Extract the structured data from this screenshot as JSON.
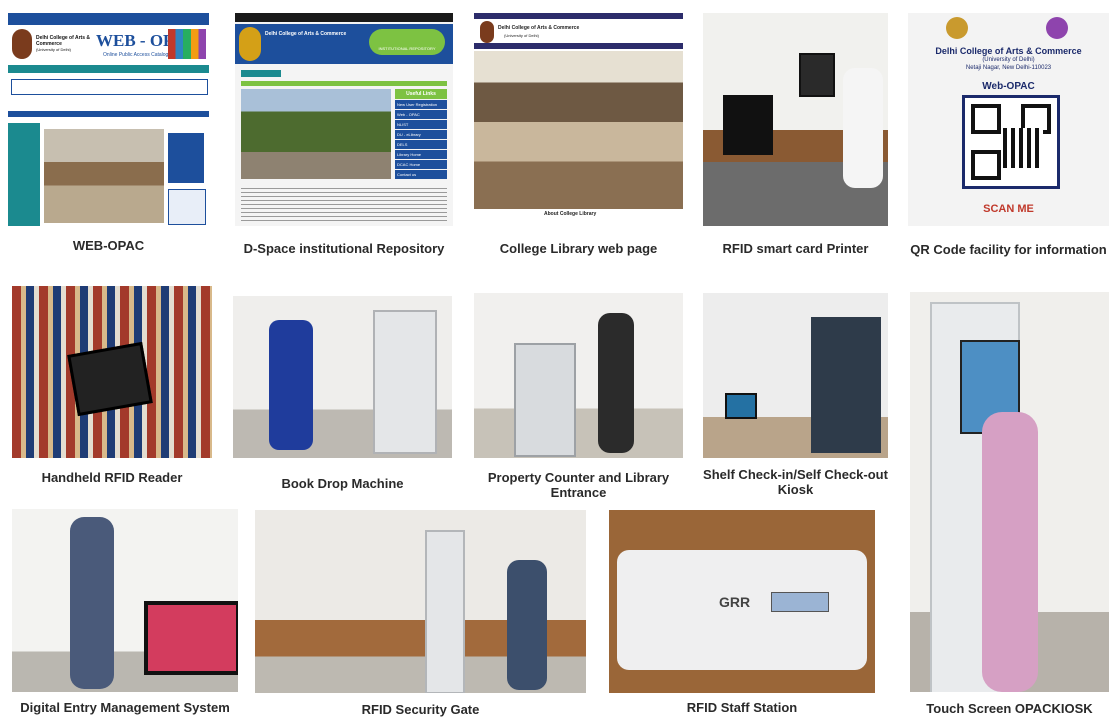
{
  "captions": {
    "web_opac": "WEB-OPAC",
    "dspace": "D-Space institutional Repository",
    "college_web": "College Library web page",
    "rfid_printer": "RFID smart card Printer",
    "qr_code": "QR Code facility for information",
    "handheld": "Handheld RFID Reader",
    "book_drop": "Book Drop Machine",
    "property_counter": "Property Counter and Library Entrance",
    "shelf_kiosk": "Shelf Check-in/Self Check-out Kiosk",
    "digital_entry": "Digital Entry Management System",
    "security_gate": "RFID Security Gate",
    "staff_station": "RFID Staff Station",
    "touch_kiosk": "Touch Screen OPACKIOSK"
  },
  "web_opac_shot": {
    "college_name": "Delhi College of Arts & Commerce",
    "college_sub": "(University of Delhi)",
    "title": "WEB - OPAC",
    "subtitle": "Online Public Access Catalog"
  },
  "dspace_shot": {
    "header_title": "Delhi College of Arts & Commerce",
    "badge": "INSTITUTIONAL REPOSITORY",
    "useful_links_title": "Useful Links",
    "links": [
      "New User Registration",
      "Web - OPAC",
      "NLIST",
      "DU - eLibrary",
      "DELS",
      "Library Home",
      "DCAC Home",
      "Contact us"
    ]
  },
  "college_web_shot": {
    "header_title": "Delhi College of Arts & Commerce",
    "sub": "(University of Delhi)",
    "about": "About College Library"
  },
  "qr_shot": {
    "college": "Delhi College of Arts & Commerce",
    "univ": "(University of Delhi)",
    "address": "Netaji Nagar, New Delhi-110023",
    "label": "Web-OPAC",
    "scan": "SCAN ME"
  },
  "staff_shot": {
    "logo": "GRR"
  },
  "colors": {
    "caption": "#2a2a2a",
    "web_blue": "#1d4f9c",
    "teal": "#1b8a8f",
    "qr_navy": "#1b2a6b",
    "qr_red": "#c0392b"
  }
}
